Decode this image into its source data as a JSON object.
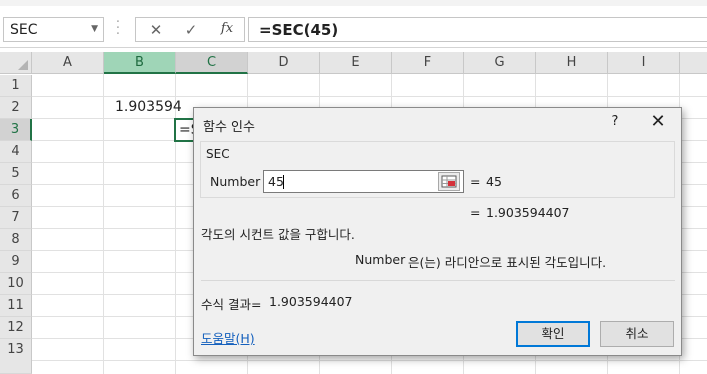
{
  "formula_bar": {
    "name_box": "SEC",
    "cancel_glyph": "✕",
    "enter_glyph": "✓",
    "fx_label": "fx",
    "formula": "=SEC(45)"
  },
  "grid": {
    "columns": [
      "A",
      "B",
      "C",
      "D",
      "E",
      "F",
      "G",
      "H",
      "I"
    ],
    "selected_column": "C",
    "rows": [
      "1",
      "2",
      "3",
      "4",
      "5",
      "6",
      "7",
      "8",
      "9",
      "10",
      "11",
      "12",
      "13"
    ],
    "selected_row": "3",
    "cells": {
      "B2": "1.903594",
      "C3": "=S"
    }
  },
  "dialog": {
    "title": "함수 인수",
    "help": "?",
    "close": "✕",
    "function_name": "SEC",
    "arg_label": "Number",
    "arg_value": "45",
    "arg_eq": "=",
    "arg_result": "45",
    "func_eq": "=",
    "func_result": "1.903594407",
    "description": "각도의 시컨트 값을 구합니다.",
    "arg_desc_name": "Number",
    "arg_desc_text": "은(는) 라디안으로 표시된 각도입니다.",
    "result_label": "수식 결과=",
    "result_value": "1.903594407",
    "help_link": "도움말(H)",
    "ok_label": "확인",
    "cancel_label": "취소"
  },
  "icons": {
    "name_box_dropdown": "chevron-down-icon",
    "collapse_dialog": "range-select-icon"
  }
}
